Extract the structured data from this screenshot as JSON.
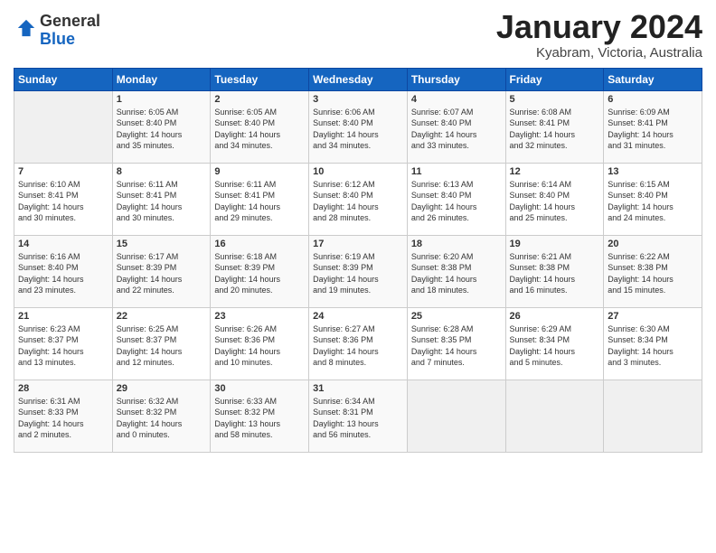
{
  "header": {
    "logo_general": "General",
    "logo_blue": "Blue",
    "month_title": "January 2024",
    "subtitle": "Kyabram, Victoria, Australia"
  },
  "days_of_week": [
    "Sunday",
    "Monday",
    "Tuesday",
    "Wednesday",
    "Thursday",
    "Friday",
    "Saturday"
  ],
  "weeks": [
    [
      {
        "day": "",
        "info": ""
      },
      {
        "day": "1",
        "info": "Sunrise: 6:05 AM\nSunset: 8:40 PM\nDaylight: 14 hours\nand 35 minutes."
      },
      {
        "day": "2",
        "info": "Sunrise: 6:05 AM\nSunset: 8:40 PM\nDaylight: 14 hours\nand 34 minutes."
      },
      {
        "day": "3",
        "info": "Sunrise: 6:06 AM\nSunset: 8:40 PM\nDaylight: 14 hours\nand 34 minutes."
      },
      {
        "day": "4",
        "info": "Sunrise: 6:07 AM\nSunset: 8:40 PM\nDaylight: 14 hours\nand 33 minutes."
      },
      {
        "day": "5",
        "info": "Sunrise: 6:08 AM\nSunset: 8:41 PM\nDaylight: 14 hours\nand 32 minutes."
      },
      {
        "day": "6",
        "info": "Sunrise: 6:09 AM\nSunset: 8:41 PM\nDaylight: 14 hours\nand 31 minutes."
      }
    ],
    [
      {
        "day": "7",
        "info": "Sunrise: 6:10 AM\nSunset: 8:41 PM\nDaylight: 14 hours\nand 30 minutes."
      },
      {
        "day": "8",
        "info": "Sunrise: 6:11 AM\nSunset: 8:41 PM\nDaylight: 14 hours\nand 30 minutes."
      },
      {
        "day": "9",
        "info": "Sunrise: 6:11 AM\nSunset: 8:41 PM\nDaylight: 14 hours\nand 29 minutes."
      },
      {
        "day": "10",
        "info": "Sunrise: 6:12 AM\nSunset: 8:40 PM\nDaylight: 14 hours\nand 28 minutes."
      },
      {
        "day": "11",
        "info": "Sunrise: 6:13 AM\nSunset: 8:40 PM\nDaylight: 14 hours\nand 26 minutes."
      },
      {
        "day": "12",
        "info": "Sunrise: 6:14 AM\nSunset: 8:40 PM\nDaylight: 14 hours\nand 25 minutes."
      },
      {
        "day": "13",
        "info": "Sunrise: 6:15 AM\nSunset: 8:40 PM\nDaylight: 14 hours\nand 24 minutes."
      }
    ],
    [
      {
        "day": "14",
        "info": "Sunrise: 6:16 AM\nSunset: 8:40 PM\nDaylight: 14 hours\nand 23 minutes."
      },
      {
        "day": "15",
        "info": "Sunrise: 6:17 AM\nSunset: 8:39 PM\nDaylight: 14 hours\nand 22 minutes."
      },
      {
        "day": "16",
        "info": "Sunrise: 6:18 AM\nSunset: 8:39 PM\nDaylight: 14 hours\nand 20 minutes."
      },
      {
        "day": "17",
        "info": "Sunrise: 6:19 AM\nSunset: 8:39 PM\nDaylight: 14 hours\nand 19 minutes."
      },
      {
        "day": "18",
        "info": "Sunrise: 6:20 AM\nSunset: 8:38 PM\nDaylight: 14 hours\nand 18 minutes."
      },
      {
        "day": "19",
        "info": "Sunrise: 6:21 AM\nSunset: 8:38 PM\nDaylight: 14 hours\nand 16 minutes."
      },
      {
        "day": "20",
        "info": "Sunrise: 6:22 AM\nSunset: 8:38 PM\nDaylight: 14 hours\nand 15 minutes."
      }
    ],
    [
      {
        "day": "21",
        "info": "Sunrise: 6:23 AM\nSunset: 8:37 PM\nDaylight: 14 hours\nand 13 minutes."
      },
      {
        "day": "22",
        "info": "Sunrise: 6:25 AM\nSunset: 8:37 PM\nDaylight: 14 hours\nand 12 minutes."
      },
      {
        "day": "23",
        "info": "Sunrise: 6:26 AM\nSunset: 8:36 PM\nDaylight: 14 hours\nand 10 minutes."
      },
      {
        "day": "24",
        "info": "Sunrise: 6:27 AM\nSunset: 8:36 PM\nDaylight: 14 hours\nand 8 minutes."
      },
      {
        "day": "25",
        "info": "Sunrise: 6:28 AM\nSunset: 8:35 PM\nDaylight: 14 hours\nand 7 minutes."
      },
      {
        "day": "26",
        "info": "Sunrise: 6:29 AM\nSunset: 8:34 PM\nDaylight: 14 hours\nand 5 minutes."
      },
      {
        "day": "27",
        "info": "Sunrise: 6:30 AM\nSunset: 8:34 PM\nDaylight: 14 hours\nand 3 minutes."
      }
    ],
    [
      {
        "day": "28",
        "info": "Sunrise: 6:31 AM\nSunset: 8:33 PM\nDaylight: 14 hours\nand 2 minutes."
      },
      {
        "day": "29",
        "info": "Sunrise: 6:32 AM\nSunset: 8:32 PM\nDaylight: 14 hours\nand 0 minutes."
      },
      {
        "day": "30",
        "info": "Sunrise: 6:33 AM\nSunset: 8:32 PM\nDaylight: 13 hours\nand 58 minutes."
      },
      {
        "day": "31",
        "info": "Sunrise: 6:34 AM\nSunset: 8:31 PM\nDaylight: 13 hours\nand 56 minutes."
      },
      {
        "day": "",
        "info": ""
      },
      {
        "day": "",
        "info": ""
      },
      {
        "day": "",
        "info": ""
      }
    ]
  ]
}
